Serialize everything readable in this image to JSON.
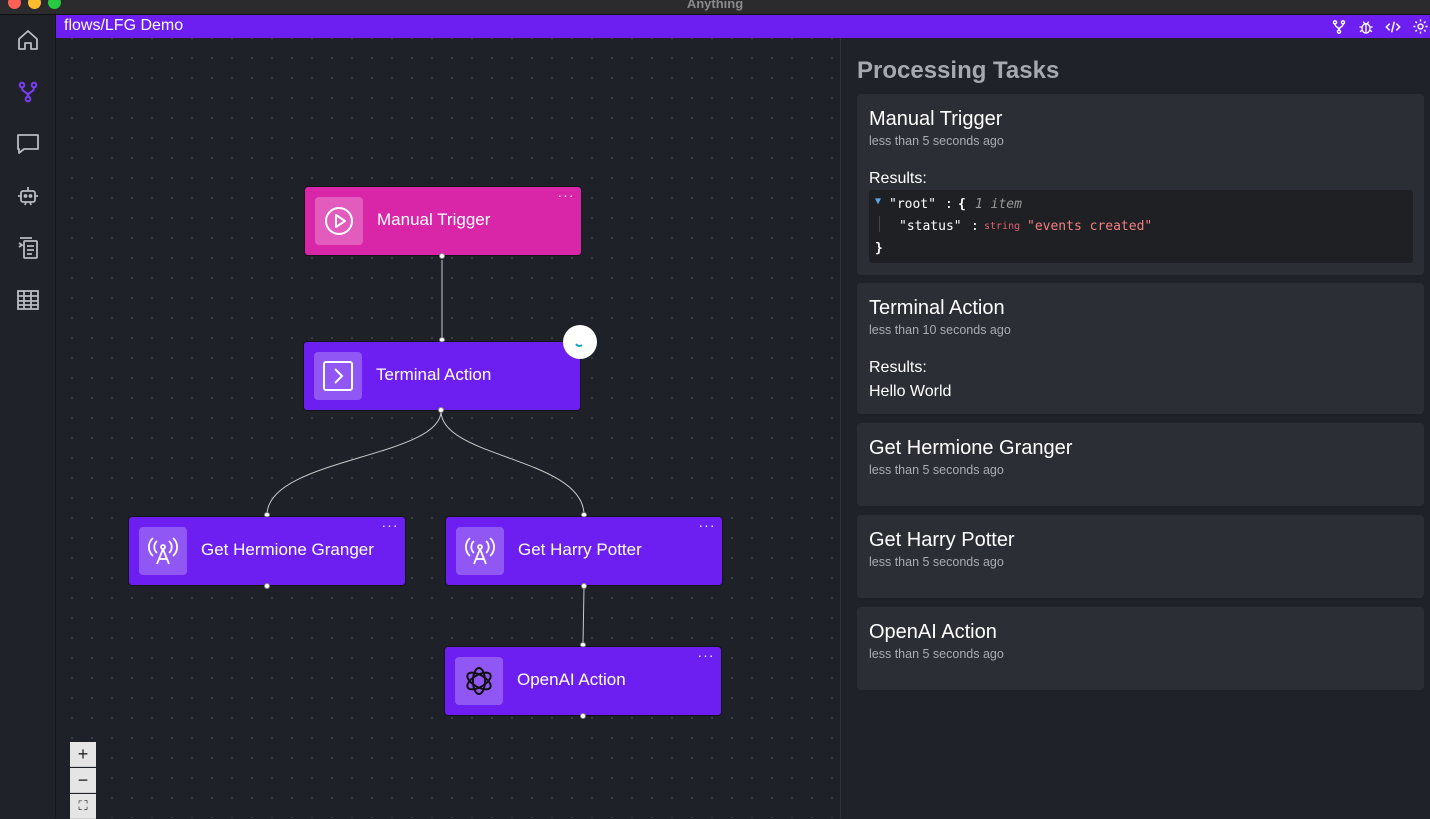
{
  "window": {
    "title": "Anything"
  },
  "header": {
    "breadcrumb": "flows/LFG Demo"
  },
  "sidebar": {
    "items": [
      {
        "icon": "home-icon"
      },
      {
        "icon": "flow-icon",
        "active": true
      },
      {
        "icon": "chat-icon"
      },
      {
        "icon": "bot-icon"
      },
      {
        "icon": "tasks-icon"
      },
      {
        "icon": "table-icon"
      }
    ]
  },
  "toolbar": {
    "icons": [
      "flow-icon",
      "bug-icon",
      "code-icon",
      "settings-icon"
    ]
  },
  "flow": {
    "nodes": [
      {
        "label": "Manual Trigger",
        "menu": "···",
        "icon": "play-icon",
        "color": "#d926a8"
      },
      {
        "label": "Terminal Action",
        "menu": "···",
        "icon": "terminal-icon",
        "color": "#6c1ff0"
      },
      {
        "label": "Get Hermione Granger",
        "menu": "···",
        "icon": "antenna-icon",
        "color": "#6c1ff0"
      },
      {
        "label": "Get Harry Potter",
        "menu": "···",
        "icon": "antenna-icon",
        "color": "#6c1ff0"
      },
      {
        "label": "OpenAI Action",
        "menu": "···",
        "icon": "openai-icon",
        "color": "#6c1ff0"
      }
    ]
  },
  "zoom_controls": {
    "zoom_in": "+",
    "zoom_out": "−",
    "fit": "⛶"
  },
  "panel": {
    "title": "Processing Tasks",
    "results_label": "Results:",
    "tasks": [
      {
        "title": "Manual Trigger",
        "time": "less than 5 seconds ago",
        "json": {
          "key": "\"root\"",
          "colon": ":",
          "brace_open": "{",
          "count": "1 item",
          "child_key": "\"status\"",
          "child_type": "string",
          "child_value": "\"events created\"",
          "brace_close": "}"
        }
      },
      {
        "title": "Terminal Action",
        "time": "less than 10 seconds ago",
        "result_text": "Hello World"
      },
      {
        "title": "Get Hermione Granger",
        "time": "less than 5 seconds ago"
      },
      {
        "title": "Get Harry Potter",
        "time": "less than 5 seconds ago"
      },
      {
        "title": "OpenAI Action",
        "time": "less than 5 seconds ago"
      }
    ]
  },
  "colors": {
    "accent": "#6c1ff0",
    "trigger": "#d926a8",
    "json_string": "#f08080",
    "json_type": "#e06070"
  }
}
